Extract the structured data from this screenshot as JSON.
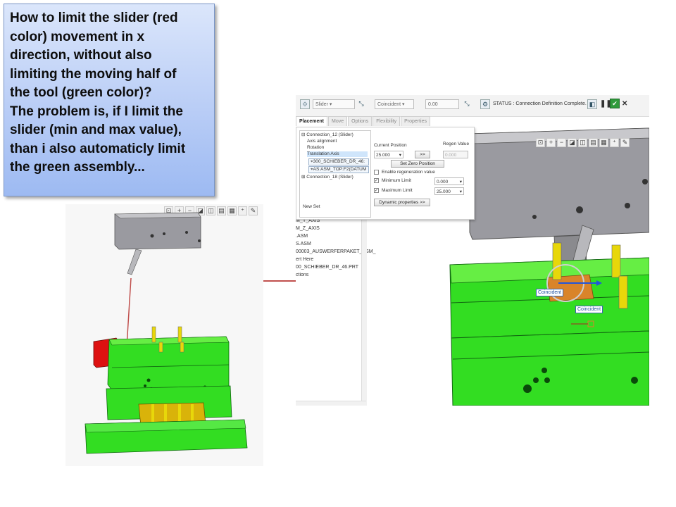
{
  "question": {
    "text": "How to limit the slider (red\ncolor) movement in x\ndirection, without also\nlimiting the moving half of\nthe tool (green color)?\nThe problem is, if I limit the\nslider (min and max value),\nthan i also automaticly limit\nthe green assembly..."
  },
  "colors": {
    "callout_border": "#7a96c8",
    "green_part": "#33dd22",
    "red_part": "#dd1111",
    "grey_part": "#9a9aa0",
    "arrow": "#c0504d"
  },
  "dashboard": {
    "connection_type": "Slider",
    "constraint_type": "Coincident",
    "offset_value": "0.00",
    "status": "STATUS : Connection Definition Complete.",
    "icons": [
      "pause-icon",
      "check-icon",
      "close-icon"
    ]
  },
  "tabs": [
    "Placement",
    "Move",
    "Options",
    "Flexibility",
    "Properties"
  ],
  "placement": {
    "tree": {
      "connection_12": "Connection_12 (Slider)",
      "items": [
        "Axis alignment",
        "Rotation",
        "Translation Axis"
      ],
      "refs": [
        "300_SCHIEBER_DR_46:",
        "AS:ASM_TOP:F2(DATUM"
      ],
      "connection_18": "Connection_18 (Slider)",
      "new_set": "New Set"
    },
    "current_position_label": "Current Position",
    "regen_value_label": "Regen Value",
    "current_position": "25.000",
    "apply_button": ">>",
    "regen_value": "0.000",
    "set_zero_button": "Set Zero Position",
    "enable_regen_label": "Enable regeneration value",
    "min_limit_label": "Minimum Limit",
    "min_limit": "0.000",
    "max_limit_label": "Maximum Limit",
    "max_limit": "25.000",
    "dynamic_button": "Dynamic properties >>"
  },
  "model_tree_fragment": [
    "M_Y_AXIS",
    "M_Z_AXIS",
    ".ASM",
    "S.ASM",
    "00003_AUSWERFERPAKET_ASM_",
    "ert Here",
    "00_SCHIEBER_DR_46.PRT",
    "ctions"
  ],
  "labels": {
    "coincident_1": "Coincident",
    "coincident_2": "Coincident"
  }
}
